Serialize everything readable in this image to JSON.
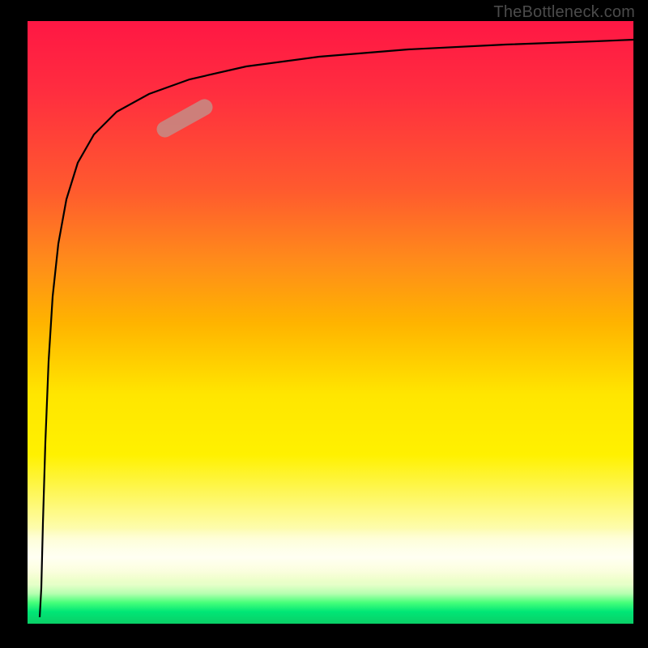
{
  "attribution": "TheBottleneck.com",
  "chart_data": {
    "type": "line",
    "title": "",
    "xlabel": "",
    "ylabel": "",
    "xlim": [
      0,
      100
    ],
    "ylim": [
      0,
      100
    ],
    "grid": false,
    "legend": false,
    "background_gradient": {
      "direction": "vertical",
      "stops": [
        {
          "pos": 0.0,
          "color": "#ff1744"
        },
        {
          "pos": 0.4,
          "color": "#ff8c1a"
        },
        {
          "pos": 0.65,
          "color": "#ffe600"
        },
        {
          "pos": 0.88,
          "color": "#fdfec7"
        },
        {
          "pos": 0.96,
          "color": "#46ff7a"
        },
        {
          "pos": 1.0,
          "color": "#0acf67"
        }
      ]
    },
    "series": [
      {
        "name": "curve",
        "note": "values estimated from pixel positions; y measured from bottom of plot",
        "x": [
          2.0,
          2.3,
          2.8,
          3.2,
          3.8,
          4.5,
          5.5,
          7.0,
          9.0,
          12.0,
          16.0,
          22.0,
          30.0,
          40.0,
          55.0,
          72.0,
          88.0,
          100.0
        ],
        "y": [
          1.0,
          8.0,
          24.0,
          40.0,
          54.0,
          64.0,
          72.0,
          78.0,
          82.5,
          86.0,
          88.5,
          90.5,
          92.2,
          93.5,
          94.6,
          95.4,
          96.0,
          96.4
        ]
      }
    ],
    "annotations": [
      {
        "name": "highlight-segment",
        "shape": "rounded-bar",
        "color": "#c98580",
        "approx_x_range": [
          22,
          30
        ],
        "approx_y_range": [
          79,
          84
        ]
      }
    ]
  }
}
